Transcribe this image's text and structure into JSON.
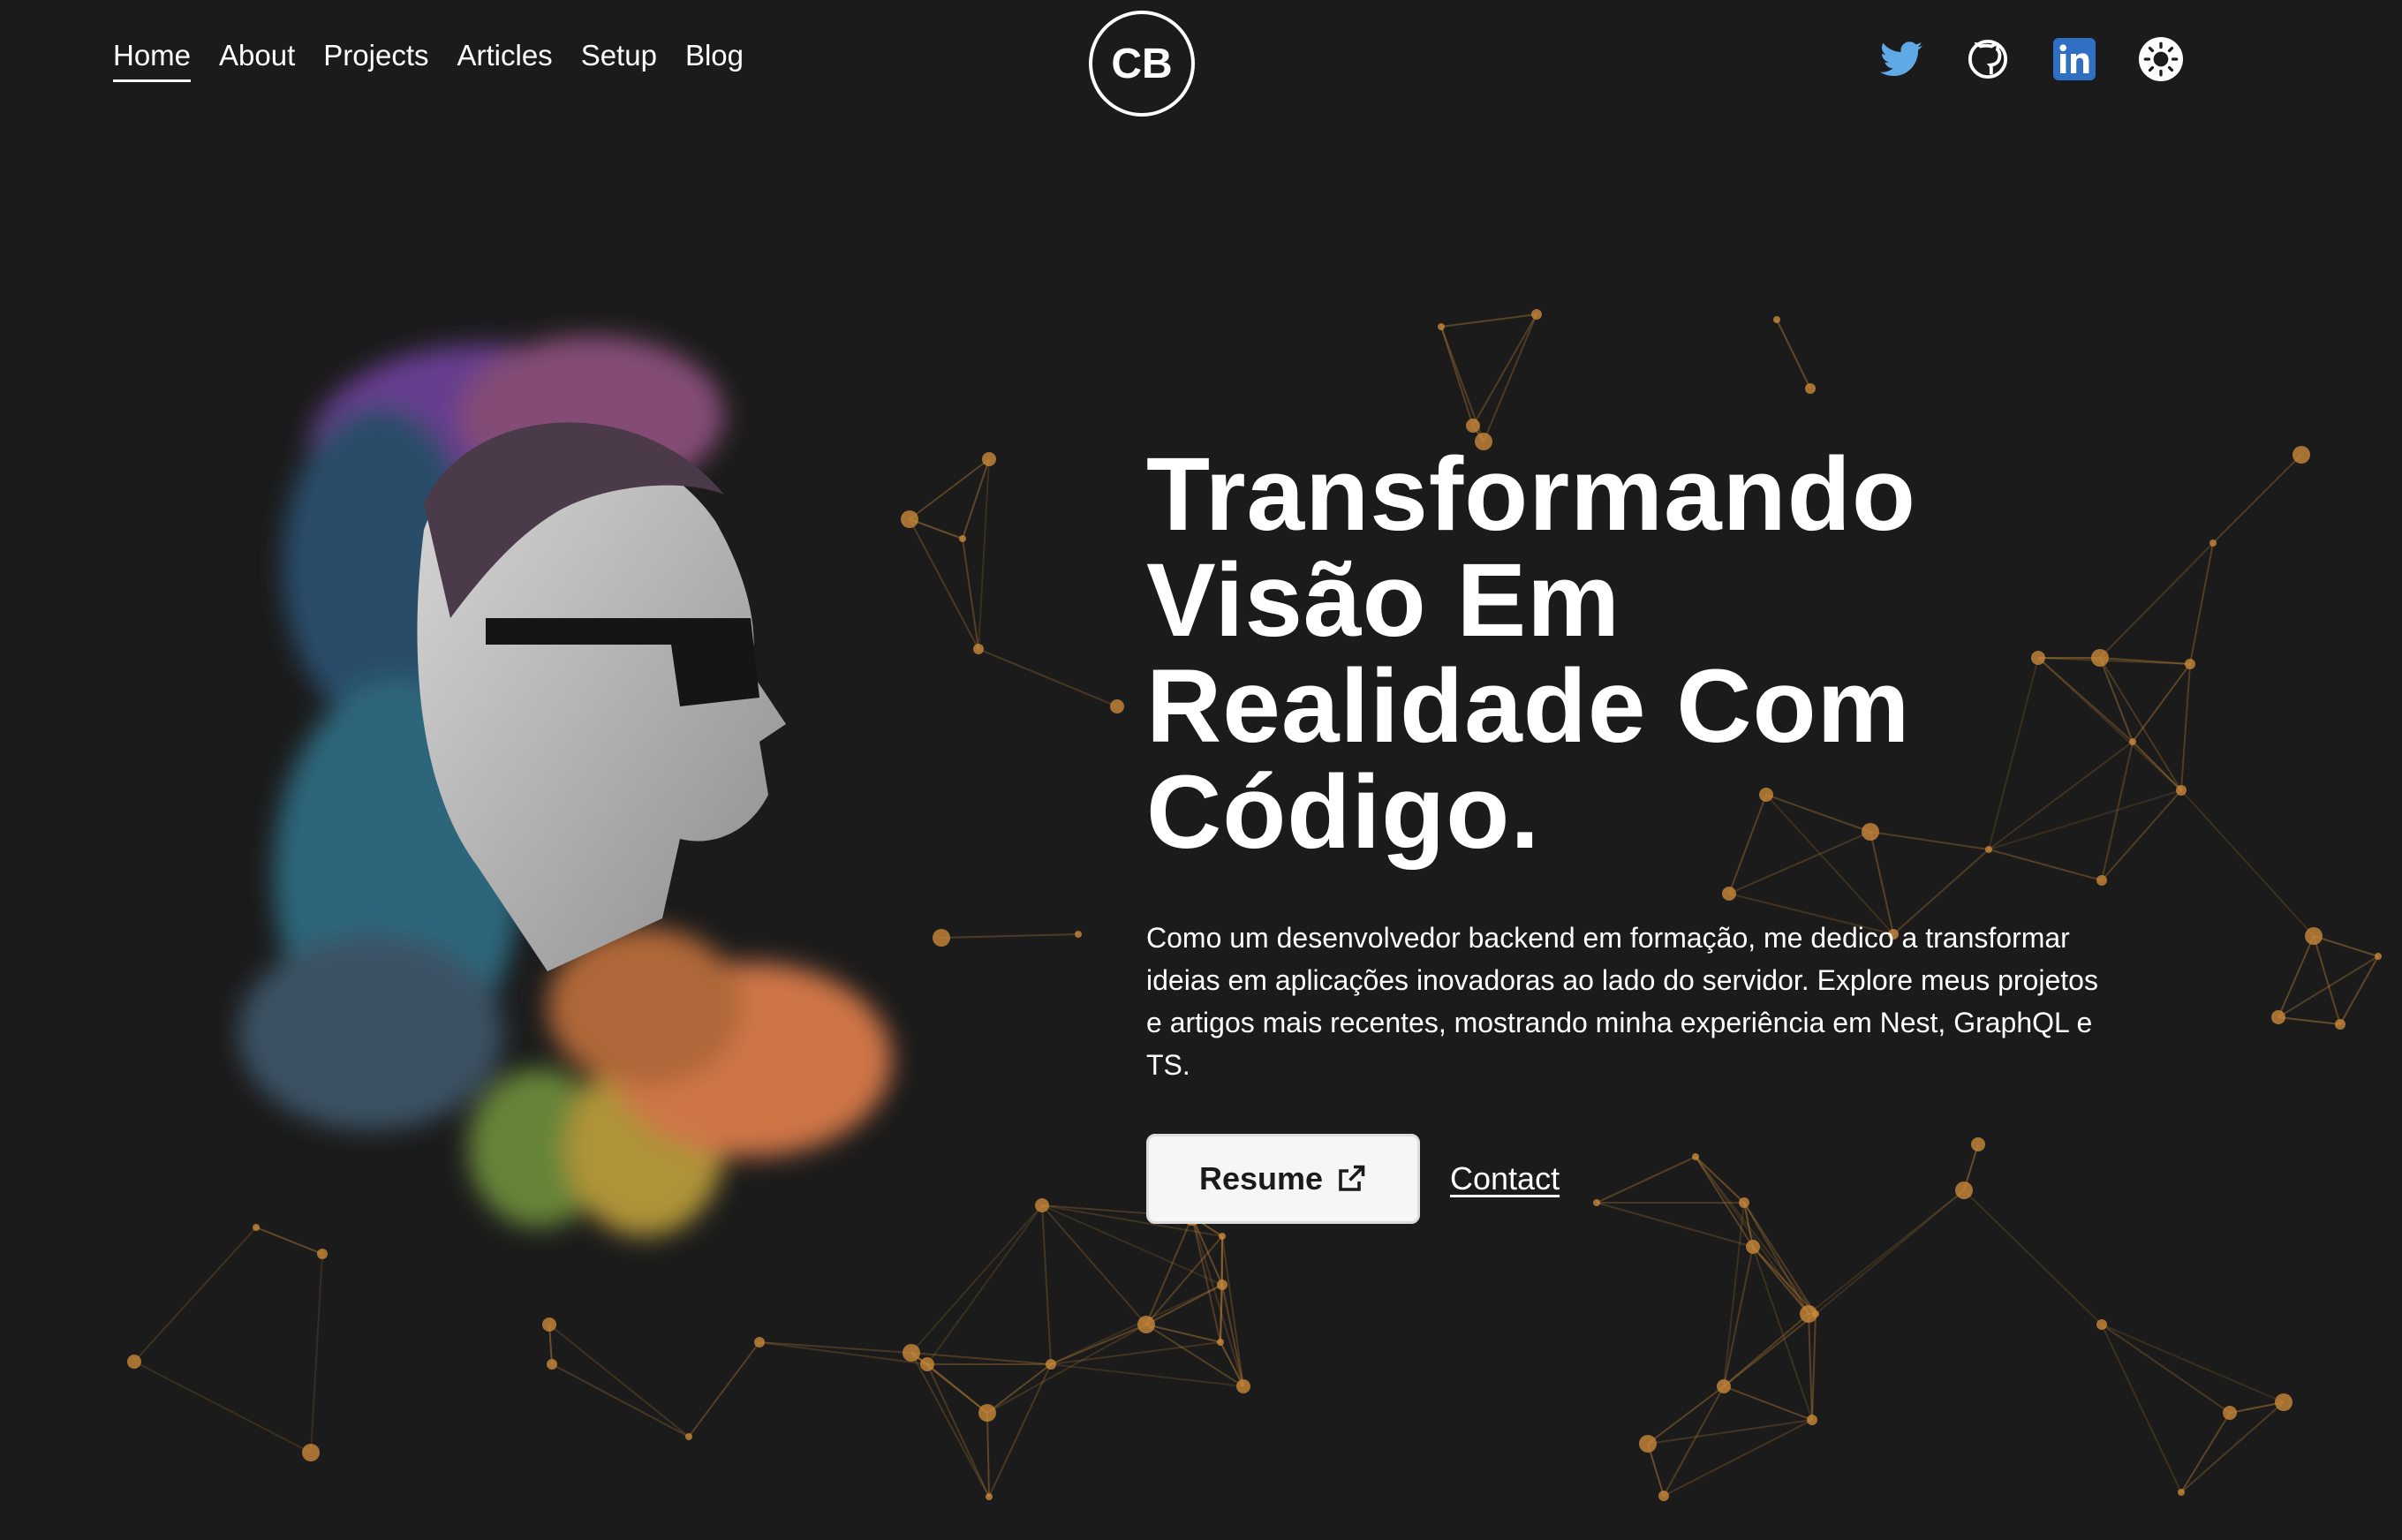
{
  "nav": {
    "items": [
      {
        "label": "Home",
        "active": true
      },
      {
        "label": "About"
      },
      {
        "label": "Projects"
      },
      {
        "label": "Articles"
      },
      {
        "label": "Setup"
      },
      {
        "label": "Blog"
      }
    ]
  },
  "logo": {
    "text": "CB"
  },
  "social": [
    {
      "icon": "twitter-icon",
      "color": "#5ea9e6"
    },
    {
      "icon": "github-icon",
      "color": "#ffffff"
    },
    {
      "icon": "linkedin-icon",
      "color": "#2f6fc4"
    },
    {
      "icon": "theme-toggle-sun-icon",
      "color": "#ffffff"
    }
  ],
  "hero": {
    "title_lines": [
      "Transformando",
      "Visão Em",
      "Realidade Com",
      "Código."
    ],
    "description": "Como um desenvolvedor backend em formação, me dedico a transformar ideias em aplicações inovadoras ao lado do servidor. Explore meus projetos e artigos mais recentes, mostrando minha experiência em Nest, GraphQL e TS.",
    "resume_label": "Resume",
    "contact_label": "Contact"
  },
  "colors": {
    "background": "#1b1b1b",
    "network_accent": "#c8883a"
  }
}
